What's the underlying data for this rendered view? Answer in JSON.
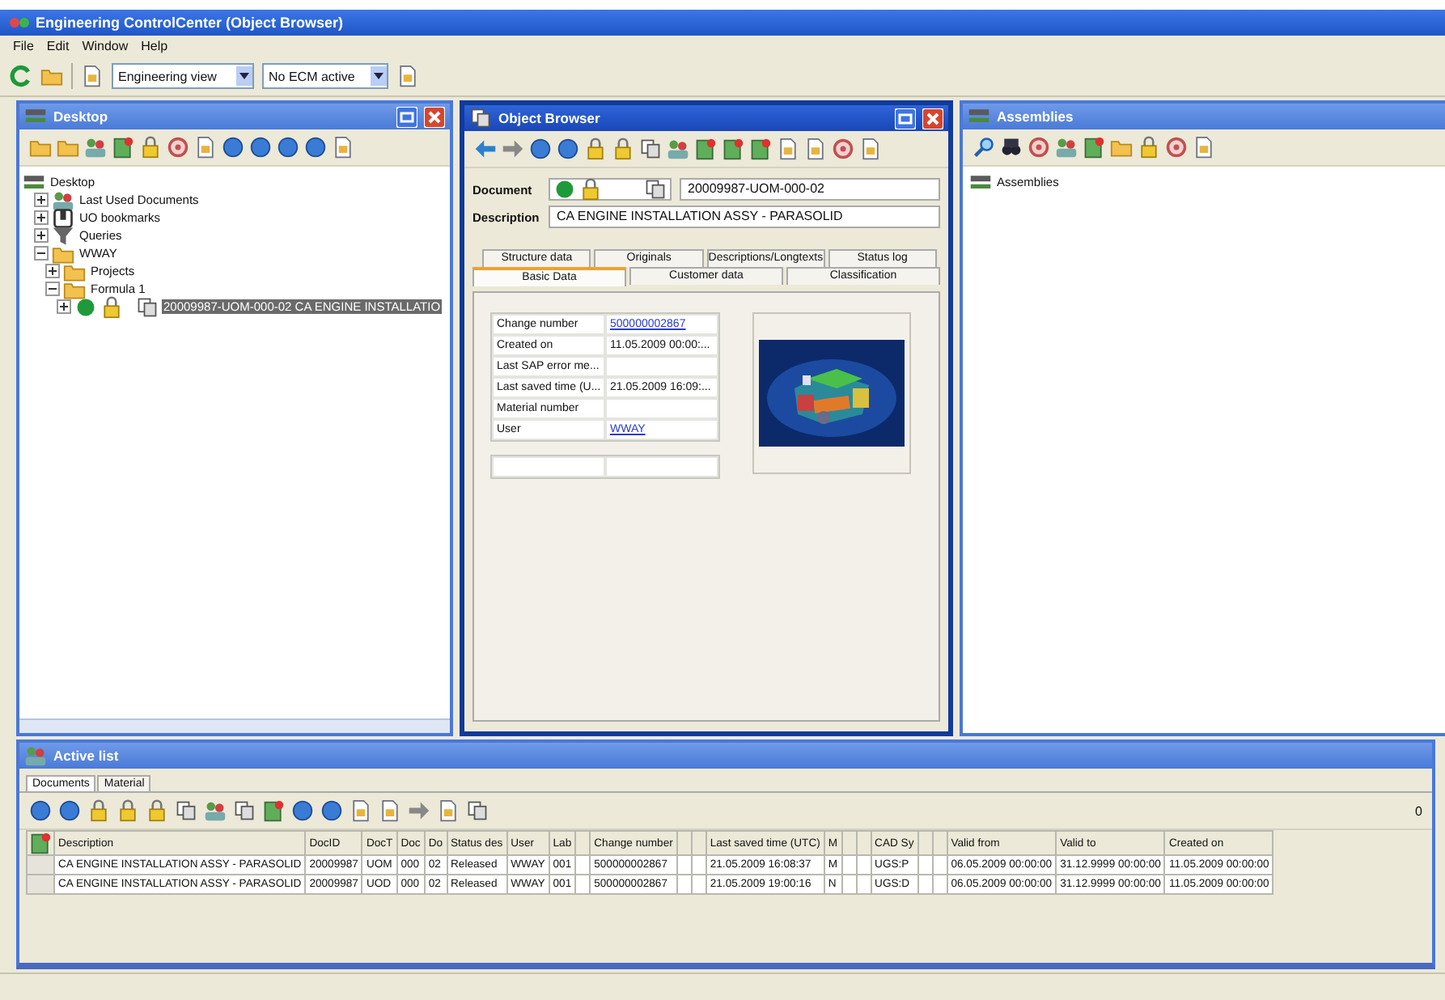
{
  "window": {
    "title": "Engineering ControlCenter (Object Browser)"
  },
  "menu": [
    "File",
    "Edit",
    "Window",
    "Help"
  ],
  "toolbar": {
    "view": "Engineering view",
    "ecm": "No ECM active"
  },
  "desktop": {
    "title": "Desktop",
    "tree": [
      {
        "label": "Desktop",
        "kind": "desktop",
        "selected": false,
        "children": [
          {
            "label": "Last Used Documents",
            "kind": "documents",
            "expanded": false,
            "selected": false
          },
          {
            "label": "UO bookmarks",
            "kind": "bookmarks",
            "expanded": false,
            "selected": false
          },
          {
            "label": "Queries",
            "kind": "queries",
            "expanded": false,
            "selected": false
          },
          {
            "label": "WWAY",
            "kind": "folder",
            "expanded": true,
            "selected": false,
            "children": [
              {
                "label": "Projects",
                "kind": "folder",
                "expanded": false,
                "selected": false
              },
              {
                "label": "Formula 1",
                "kind": "folder",
                "expanded": true,
                "selected": false,
                "children": [
                  {
                    "label": "20009987-UOM-000-02 CA ENGINE INSTALLATIO",
                    "kind": "document",
                    "expanded": false,
                    "selected": true
                  }
                ]
              }
            ]
          }
        ]
      }
    ]
  },
  "object_browser": {
    "title": "Object Browser",
    "document_label": "Document",
    "document": "20009987-UOM-000-02",
    "description_label": "Description",
    "description": "CA ENGINE INSTALLATION ASSY - PARASOLID",
    "tab_rows": [
      [
        {
          "label": "Structure data",
          "selected": false
        },
        {
          "label": "Originals",
          "selected": false
        },
        {
          "label": "Descriptions/Longtexts",
          "selected": false
        },
        {
          "label": "Status log",
          "selected": false
        }
      ],
      [
        {
          "label": "Basic Data",
          "selected": true
        },
        {
          "label": "Customer data",
          "selected": false
        },
        {
          "label": "Classification",
          "selected": false
        }
      ]
    ],
    "properties": [
      {
        "label": "Change number",
        "value": "500000002867",
        "kind": "link"
      },
      {
        "label": "Created on",
        "value": "11.05.2009 00:00:...",
        "kind": "text"
      },
      {
        "label": "Last SAP error me...",
        "kind": "text"
      },
      {
        "label": "Last saved time (U...",
        "value": "21.05.2009 16:09:...",
        "kind": "text"
      },
      {
        "label": "Material number",
        "kind": "text"
      },
      {
        "label": "User",
        "value": "WWAY",
        "kind": "link"
      }
    ],
    "preview": {
      "kind": "picture"
    }
  },
  "assemblies": {
    "title": "Assemblies",
    "tree": [
      {
        "label": "Assemblies"
      }
    ]
  },
  "active_list": {
    "title": "Active list",
    "tabs": [
      {
        "label": "Documents",
        "selected": true
      },
      {
        "label": "Material",
        "selected": false
      }
    ],
    "counter": "0",
    "columns": [
      "Description",
      "DocID",
      "DocT",
      "Doc",
      "Do",
      "Status des",
      "User",
      "Lab",
      null,
      "Change number",
      null,
      null,
      "Last saved time (UTC)",
      "M",
      null,
      null,
      "CAD Sy",
      null,
      null,
      "Valid from",
      "Valid to",
      "Created on"
    ],
    "rows": [
      [
        "CA ENGINE INSTALLATION ASSY - PARASOLID",
        "20009987",
        "UOM",
        "000",
        "02",
        "Released",
        "WWAY",
        "001",
        null,
        "500000002867",
        null,
        null,
        "21.05.2009 16:08:37",
        "M",
        null,
        null,
        "UGS:P",
        null,
        null,
        "06.05.2009 00:00:00",
        "31.12.9999 00:00:00",
        "11.05.2009 00:00:00"
      ],
      [
        "CA ENGINE INSTALLATION ASSY - PARASOLID",
        "20009987",
        "UOD",
        "000",
        "02",
        "Released",
        "WWAY",
        "001",
        null,
        "500000002867",
        null,
        null,
        "21.05.2009 19:00:16",
        "N",
        null,
        null,
        "UGS:D",
        null,
        null,
        "06.05.2009 00:00:00",
        "31.12.9999 00:00:00",
        "11.05.2009 00:00:00"
      ]
    ]
  }
}
